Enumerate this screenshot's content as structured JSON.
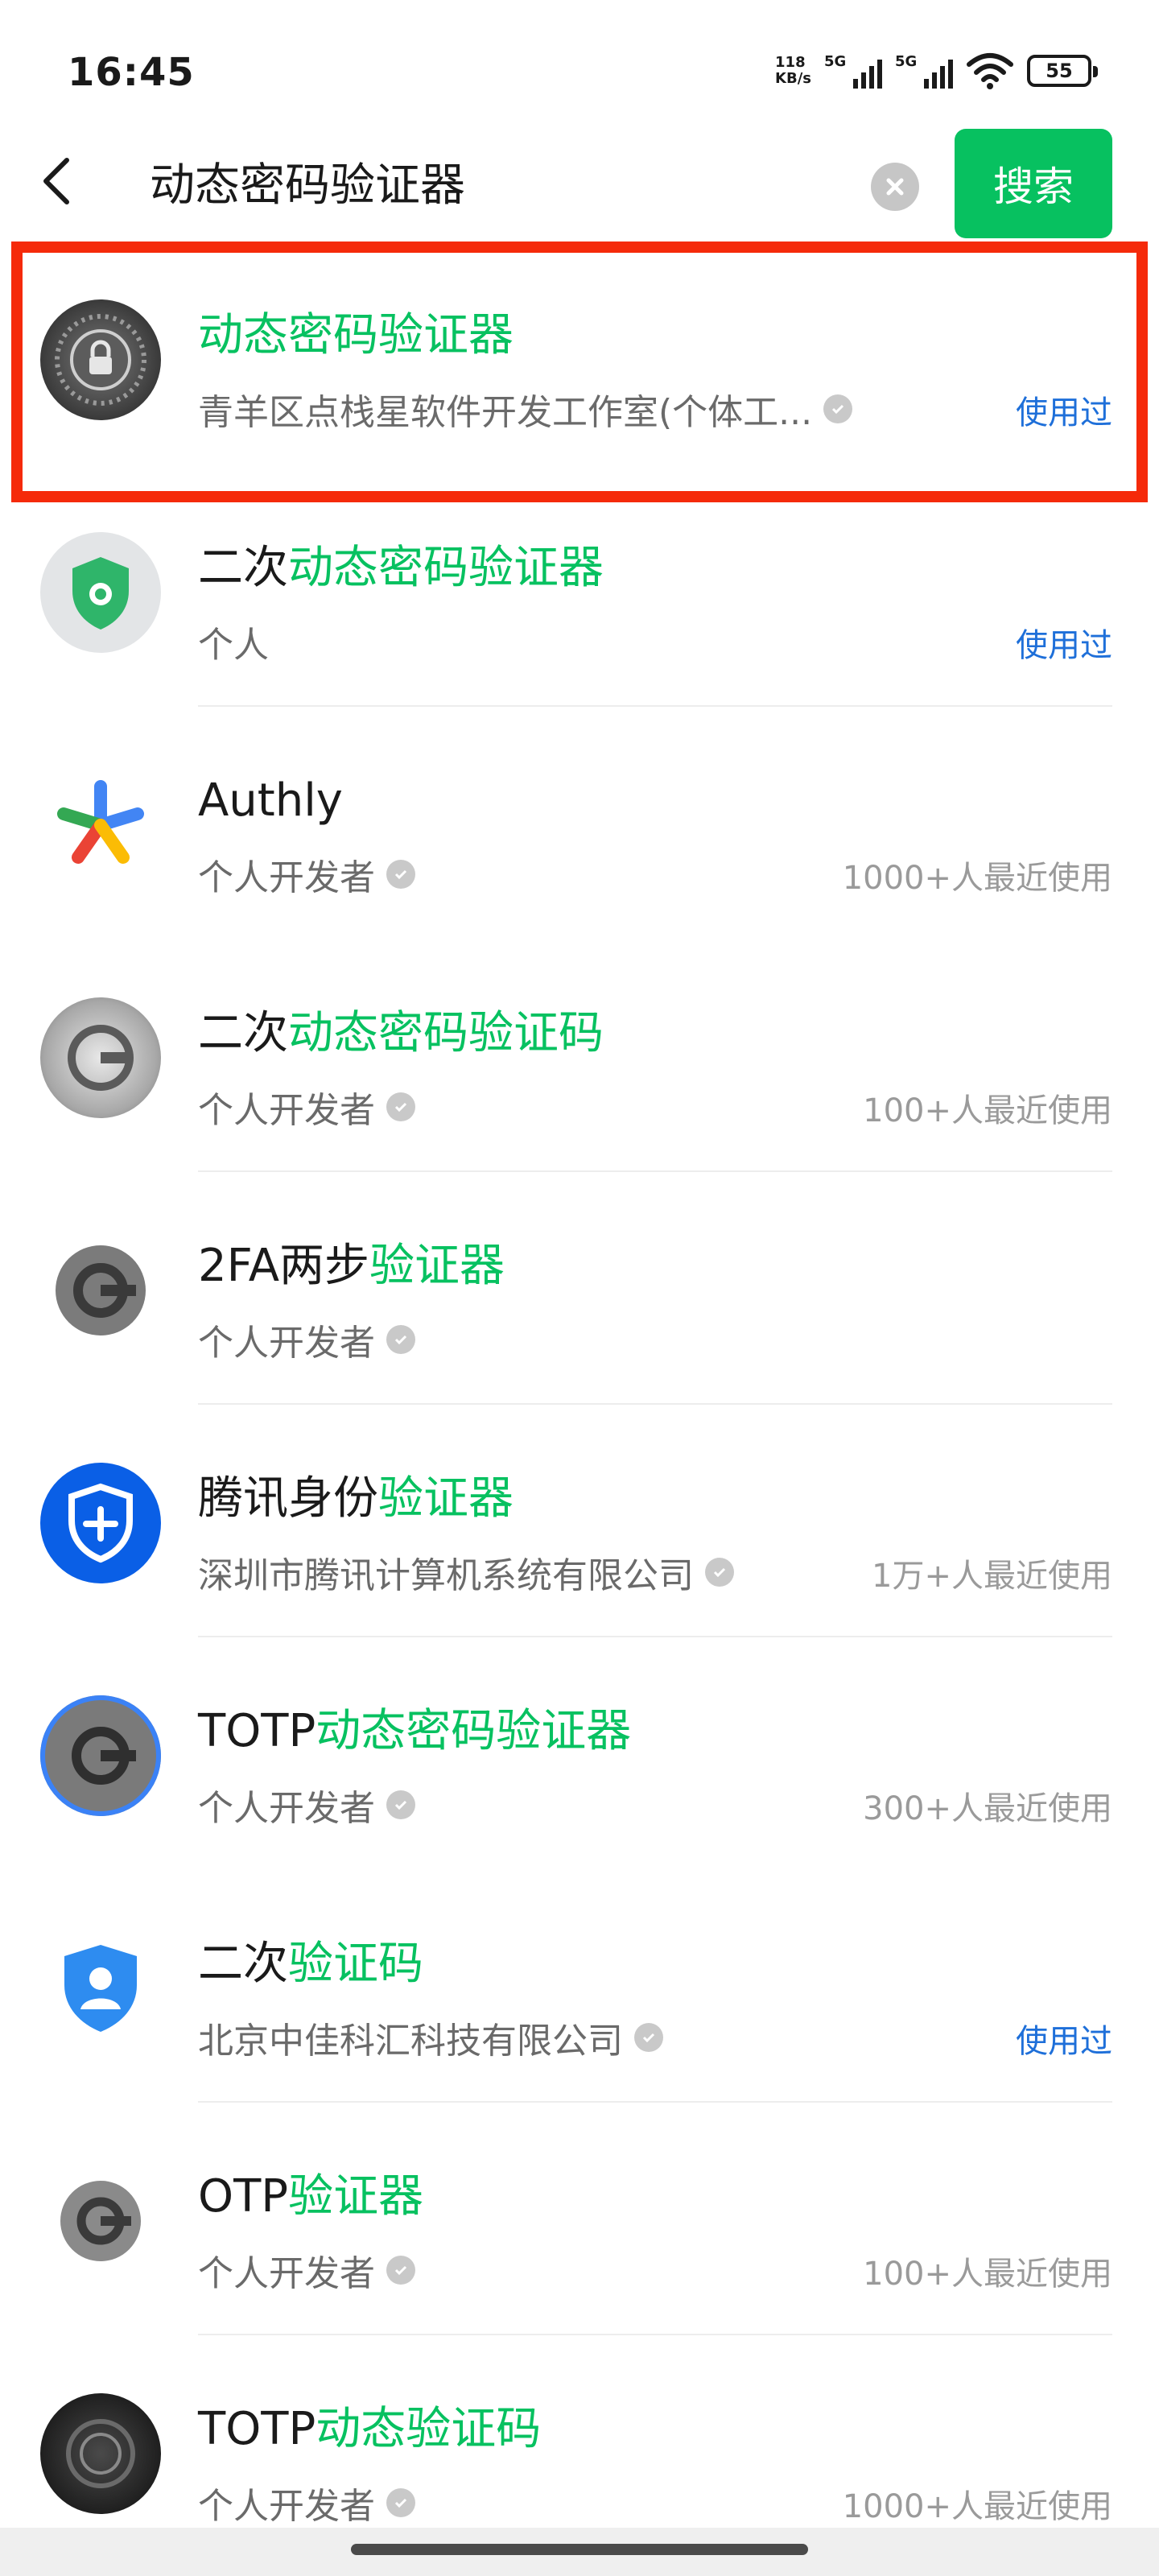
{
  "status_bar": {
    "time": "16:45",
    "net_speed_value": "118",
    "net_speed_unit": "KB/s",
    "signal1_label": "5G",
    "signal2_label": "5G",
    "battery": "55"
  },
  "search": {
    "query": "动态密码验证器",
    "button_label": "搜索"
  },
  "results": [
    {
      "title_prefix": "",
      "title_highlight": "动态密码验证器",
      "subtitle": "青羊区点栈星软件开发工作室(个体工...",
      "verified": true,
      "meta": "使用过",
      "meta_type": "used",
      "icon": "lock-dial-icon"
    },
    {
      "title_prefix": "二次",
      "title_highlight": "动态密码验证器",
      "subtitle": "个人",
      "verified": false,
      "meta": "使用过",
      "meta_type": "used",
      "icon": "green-shield-icon"
    },
    {
      "title_prefix": "Authly",
      "title_highlight": "",
      "subtitle": "个人开发者",
      "verified": true,
      "meta": "1000+人最近使用",
      "meta_type": "count",
      "icon": "colorful-star-icon"
    },
    {
      "title_prefix": "二次",
      "title_highlight": "动态密码验证码",
      "subtitle": "个人开发者",
      "verified": true,
      "meta": "100+人最近使用",
      "meta_type": "count",
      "icon": "metal-g-icon"
    },
    {
      "title_prefix": "2FA两步",
      "title_highlight": "验证器",
      "subtitle": "个人开发者",
      "verified": true,
      "meta": "",
      "meta_type": "none",
      "icon": "gray-g-icon"
    },
    {
      "title_prefix": "腾讯身份",
      "title_highlight": "验证器",
      "subtitle": "深圳市腾讯计算机系统有限公司",
      "verified": true,
      "meta": "1万+人最近使用",
      "meta_type": "count",
      "icon": "blue-shield-plus-icon"
    },
    {
      "title_prefix": "TOTP",
      "title_highlight": "动态密码验证器",
      "subtitle": "个人开发者",
      "verified": true,
      "meta": "300+人最近使用",
      "meta_type": "count",
      "icon": "blue-ring-g-icon"
    },
    {
      "title_prefix": "二次",
      "title_highlight": "验证码",
      "subtitle": "北京中佳科汇科技有限公司",
      "verified": true,
      "meta": "使用过",
      "meta_type": "used",
      "icon": "blue-user-shield-icon"
    },
    {
      "title_prefix": "OTP",
      "title_highlight": "验证器",
      "subtitle": "个人开发者",
      "verified": true,
      "meta": "100+人最近使用",
      "meta_type": "count",
      "icon": "gray-g-icon"
    },
    {
      "title_prefix": "TOTP",
      "title_highlight": "动态验证码",
      "subtitle": "个人开发者",
      "verified": true,
      "meta": "1000+人最近使用",
      "meta_type": "count",
      "icon": "dark-dial-icon"
    }
  ],
  "colors": {
    "accent_green": "#07c160",
    "used_blue": "#1e6fd9",
    "highlight_red": "#f52a0a"
  }
}
